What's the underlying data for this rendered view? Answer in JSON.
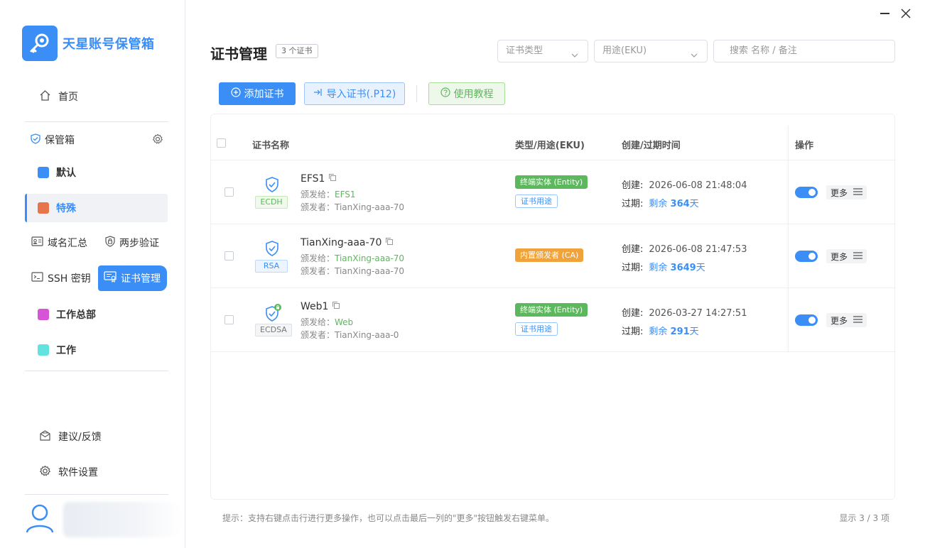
{
  "app": {
    "name": "天星账号保管箱",
    "brand_color": "#3a8ef6"
  },
  "window_controls": [
    "minimize-icon",
    "close-icon"
  ],
  "sidebar": {
    "home": "首页",
    "vault_header": "保管箱",
    "vaults": [
      {
        "label": "默认",
        "color": "#3a8ef6"
      },
      {
        "label": "特殊",
        "color": "#e8744b",
        "active": true
      },
      {
        "label": "工作总部",
        "color": "#d655d6"
      },
      {
        "label": "工作",
        "color": "#62e3e0"
      }
    ],
    "tools": [
      {
        "label": "域名汇总",
        "icon": "id-card-icon"
      },
      {
        "label": "两步验证",
        "icon": "shield-lock-icon"
      },
      {
        "label": "SSH 密钥",
        "icon": "terminal-icon"
      },
      {
        "label": "证书管理",
        "icon": "certificate-icon",
        "active": true
      }
    ],
    "feedback": "建议/反馈",
    "settings": "软件设置"
  },
  "header": {
    "title": "证书管理",
    "count_badge": "3 个证书",
    "filter_type_placeholder": "证书类型",
    "filter_eku_placeholder": "用途(EKU)",
    "search_placeholder": "搜索 名称 / 备注"
  },
  "toolbar": {
    "add": "添加证书",
    "import": "导入证书(.P12)",
    "tutorial": "使用教程"
  },
  "table": {
    "columns": [
      "证书名称",
      "类型/用途(EKU)",
      "创建/过期时间",
      "操作"
    ],
    "issued_to_label": "颁发给：",
    "issuer_label": "颁发者：",
    "created_label": "创建:",
    "expires_label": "过期:",
    "more_label": "更多",
    "rows": [
      {
        "name": "EFS1",
        "algo": "ECDH",
        "issued_to": "EFS1",
        "issuer": "TianXing-aaa-70",
        "type_tag": "终端实体 (Entity)",
        "eku_tag": "证书用途",
        "created": "2026-06-08 21:48:04",
        "remain_prefix": "剩余 ",
        "remain_days": "364",
        "remain_suffix": "天",
        "enabled": true
      },
      {
        "name": "TianXing-aaa-70",
        "algo": "RSA",
        "issued_to": "TianXing-aaa-70",
        "issuer": "TianXing-aaa-70",
        "type_tag": "内置颁发者 (CA)",
        "eku_tag": "",
        "created": "2026-06-08 21:47:53",
        "remain_prefix": "剩余 ",
        "remain_days": "3649",
        "remain_suffix": "天",
        "enabled": true
      },
      {
        "name": "Web1",
        "algo": "ECDSA",
        "issued_to": "Web",
        "issuer": "TianXing-aaa-0",
        "type_tag": "终端实体 (Entity)",
        "eku_tag": "证书用途",
        "created": "2026-03-27 14:27:51",
        "remain_prefix": "剩余 ",
        "remain_days": "291",
        "remain_suffix": "天",
        "enabled": true
      }
    ]
  },
  "footer": {
    "tip": "提示：支持右键点击行进行更多操作，也可以点击最后一列的\"更多\"按钮触发右键菜单。",
    "count": "显示 3 / 3 项"
  }
}
